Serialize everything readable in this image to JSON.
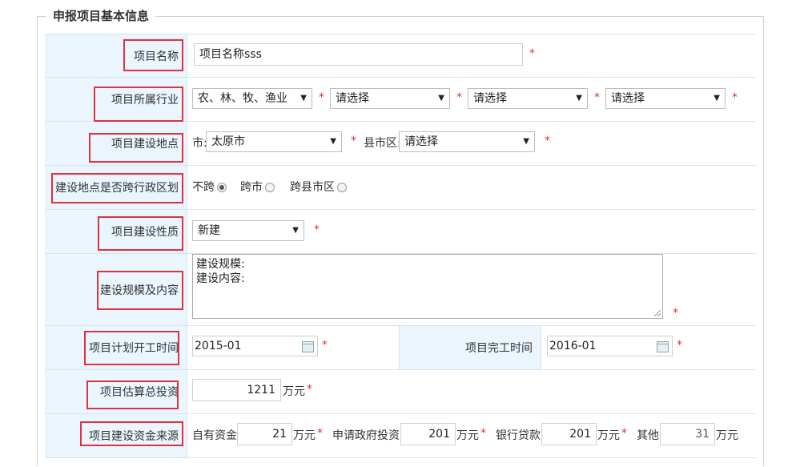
{
  "legend": "申报项目基本信息",
  "required_mark": "*",
  "rows": {
    "name": {
      "label": "项目名称",
      "value": "项目名称sss"
    },
    "industry": {
      "label": "项目所属行业",
      "selects": [
        "农、林、牧、渔业",
        "请选择",
        "请选择",
        "请选择"
      ]
    },
    "location": {
      "label": "项目建设地点",
      "city_label": "市:",
      "city": "太原市",
      "county_label": "县市区:",
      "county": "请选择"
    },
    "cross": {
      "label": "建设地点是否跨行政区划",
      "options": [
        "不跨",
        "跨市",
        "跨县市区"
      ]
    },
    "nature": {
      "label": "项目建设性质",
      "value": "新建"
    },
    "scale": {
      "label": "建设规模及内容",
      "line1": "建设规模:",
      "line2": "建设内容:"
    },
    "start": {
      "label": "项目计划开工时间",
      "value": "2015-01",
      "end_label": "项目完工时间",
      "end_value": "2016-01"
    },
    "invest": {
      "label": "项目估算总投资",
      "value": "1211",
      "unit": "万元"
    },
    "funding": {
      "label": "项目建设资金来源",
      "own_label": "自有资金",
      "own": "21",
      "gov_label": "申请政府投资",
      "gov": "201",
      "bank_label": "银行贷款",
      "bank": "201",
      "other_label": "其他",
      "other": "31",
      "unit": "万元"
    }
  },
  "colors": {
    "highlight": "#e0313e",
    "label_bg": "#eaf5fd",
    "required": "#e03232"
  }
}
